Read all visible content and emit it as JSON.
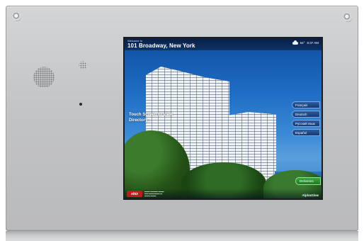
{
  "screen": {
    "welcome": "Welcome to",
    "address": "101 Broadway, New York",
    "weather": {
      "icon": "cloud-icon",
      "temperature": "54°",
      "time": "6:37 AM"
    },
    "touch_prompt": "Touch Screen to View Directory...",
    "languages": [
      "Français",
      "Deutsch",
      "Русский язык",
      "Español"
    ],
    "deliveries_label": "Deliveries",
    "footer": {
      "logo_left": "vbiz",
      "logo_right": "AlphaGlow"
    }
  },
  "colors": {
    "panel": "#c6c7c9",
    "screen_header": "#0c2854",
    "language_button": "#1e4a86",
    "deliveries_button": "#2e9533",
    "logo_red": "#c8161d"
  }
}
